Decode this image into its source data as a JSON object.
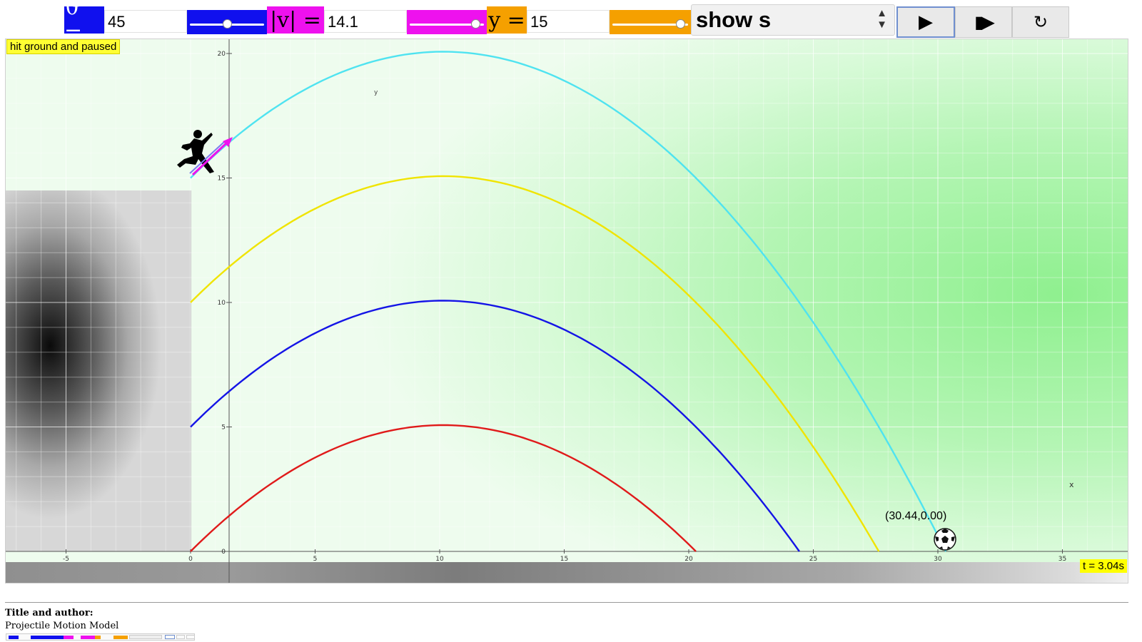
{
  "controls": {
    "theta": {
      "symbol": "ϑ =",
      "value": "45",
      "color": "#1010ee",
      "slider_fraction": 0.5
    },
    "speed": {
      "symbol": "|v| =",
      "value": "14.1",
      "color": "#ee11ee",
      "slider_fraction": 0.95
    },
    "height": {
      "symbol": "y =",
      "value": "15",
      "color": "#f5a000",
      "slider_fraction": 0.96
    },
    "mode_select": {
      "value": "show s"
    },
    "buttons": {
      "play": "▶",
      "step": "▮▶",
      "reset": "↻"
    }
  },
  "simulation": {
    "status": "hit ground and paused",
    "time": "t = 3.04s",
    "ball_coordinate": "(30.44,0.00)",
    "axis_x_name": "x",
    "axis_y_name": "y",
    "x_ticks": [
      "-5",
      "0",
      "5",
      "10",
      "15",
      "20",
      "25",
      "30",
      "35"
    ],
    "y_ticks": [
      "0",
      "5",
      "10",
      "15",
      "20"
    ],
    "trajectories": [
      {
        "color": "#e01a1a",
        "launch_height": 0
      },
      {
        "color": "#1414e6",
        "launch_height": 5
      },
      {
        "color": "#f0e400",
        "launch_height": 10
      },
      {
        "color": "#4fe3f0",
        "launch_height": 15
      }
    ],
    "velocity_arrow_color": "#ee11ee",
    "icons": {
      "player": "soccer-player-silhouette",
      "ball": "soccer-ball"
    }
  },
  "footer": {
    "heading": "Title and author:",
    "title": "Projectile Motion Model"
  }
}
